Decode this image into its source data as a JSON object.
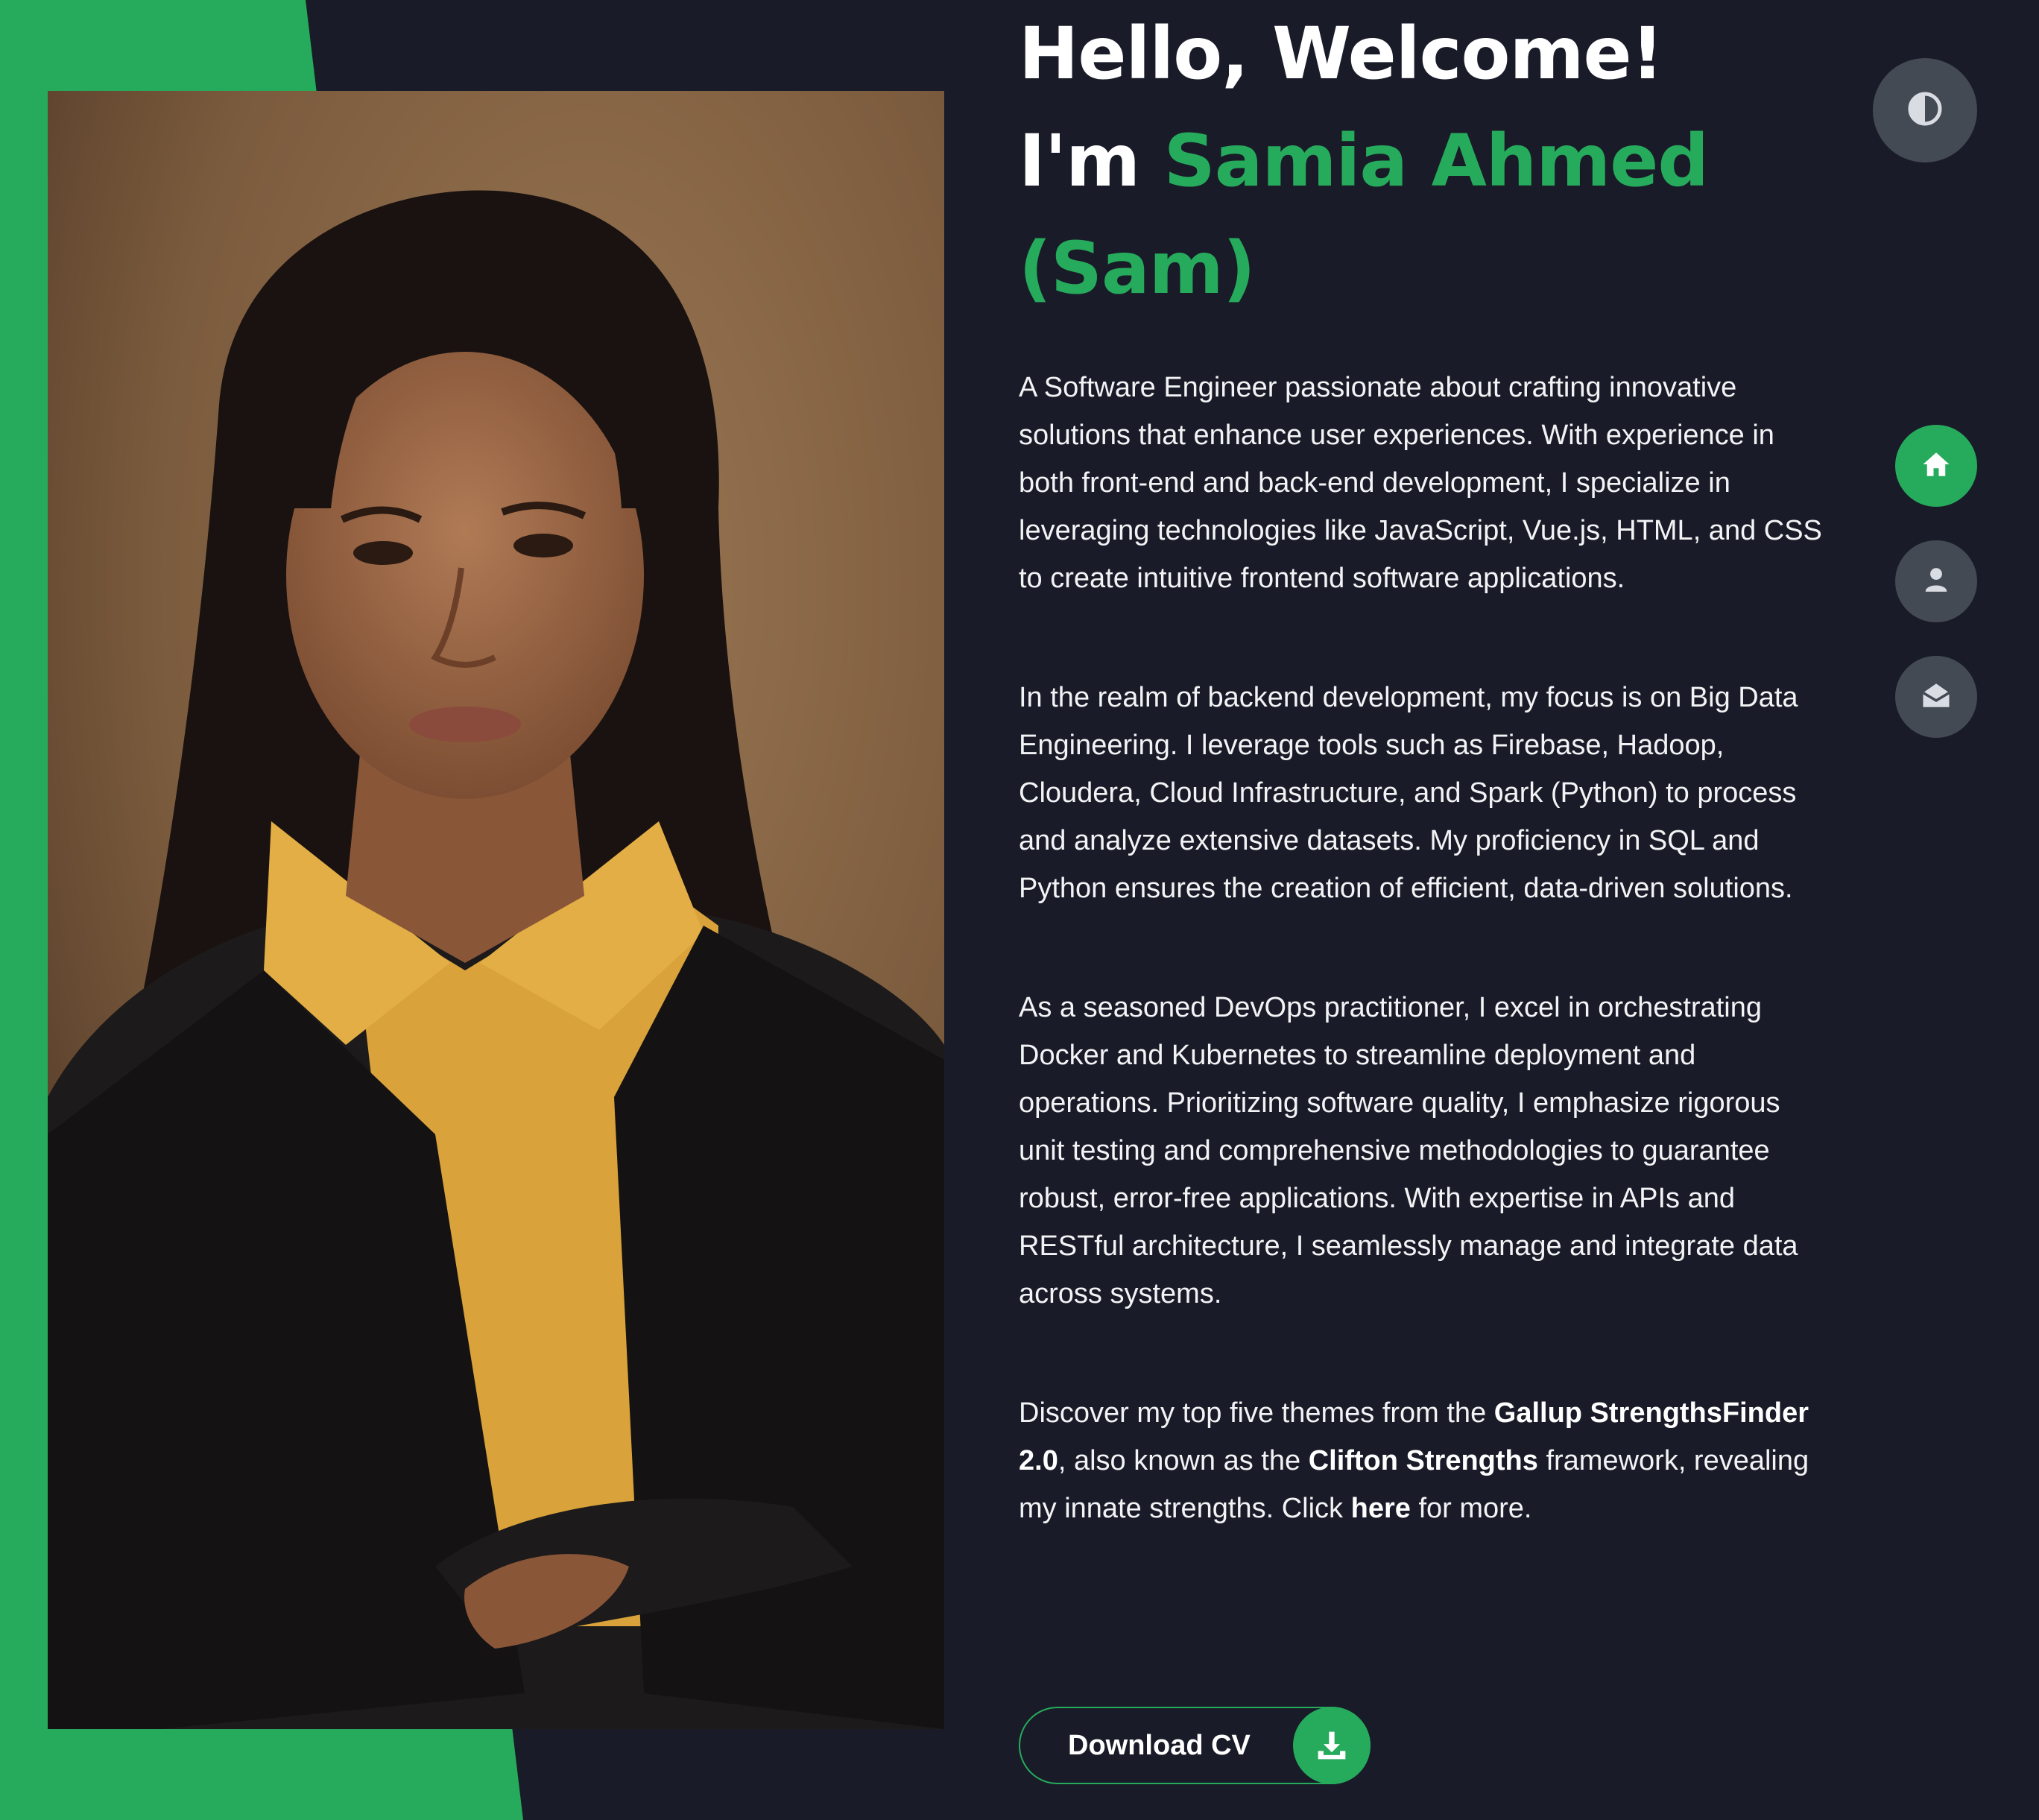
{
  "colors": {
    "accent": "#26ab5c",
    "background": "#191c28",
    "button_gray": "#444a54",
    "text": "#ffffff"
  },
  "hero": {
    "greeting": "Hello, Welcome!",
    "intro_prefix": "I'm ",
    "name": "Samia Ahmed",
    "nickname": "(Sam)"
  },
  "bio": {
    "p1": "A Software Engineer passionate about crafting innovative solutions that enhance user experiences. With experience in both front-end and back-end development, I specialize in leveraging technologies like JavaScript, Vue.js, HTML, and CSS to create intuitive frontend software applications.",
    "p2": "In the realm of backend development, my focus is on Big Data Engineering. I leverage tools such as Firebase, Hadoop, Cloudera, Cloud Infrastructure, and Spark (Python) to process and analyze extensive datasets. My proficiency in SQL and Python ensures the creation of efficient, data-driven solutions.",
    "p3": "As a seasoned DevOps practitioner, I excel in orchestrating Docker and Kubernetes to streamline deployment and operations. Prioritizing software quality, I emphasize rigorous unit testing and comprehensive methodologies to guarantee robust, error-free applications. With expertise in APIs and RESTful architecture, I seamlessly manage and integrate data across systems.",
    "p4": {
      "text_1": "Discover my top five themes from the ",
      "bold_1": "Gallup StrengthsFinder 2.0",
      "text_2": ", also known as the ",
      "bold_2": "Clifton Strengths",
      "text_3": " framework, revealing my innate strengths. Click ",
      "link": "here",
      "text_4": " for more."
    }
  },
  "download": {
    "label": "Download CV",
    "icon": "download-icon"
  },
  "controls": {
    "theme_toggle_icon": "contrast-icon",
    "nav": [
      {
        "icon": "home-icon",
        "active": true
      },
      {
        "icon": "user-icon",
        "active": false
      },
      {
        "icon": "envelope-open-icon",
        "active": false
      }
    ]
  },
  "photo": {
    "subject": "portrait-photo"
  }
}
